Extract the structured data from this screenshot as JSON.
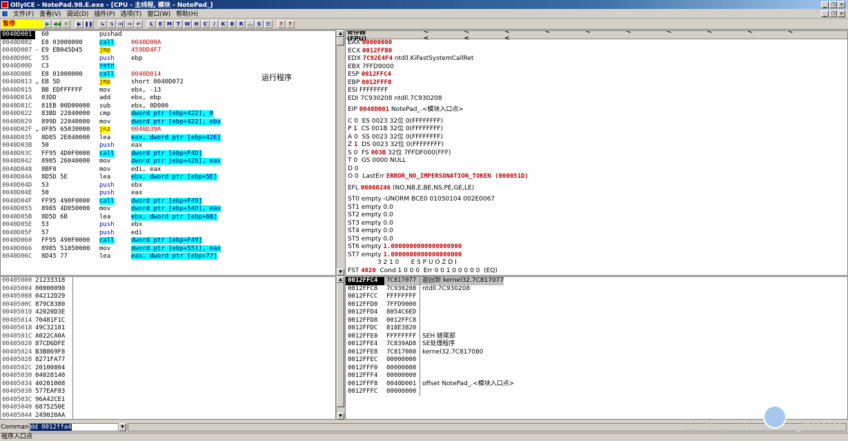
{
  "window": {
    "title": "OllyICE - NotePad.98.E.exe - [CPU - 主线程, 模块 - NotePad_]"
  },
  "menu": [
    "文件(F)",
    "查看(V)",
    "调试(D)",
    "插件(P)",
    "选项(T)",
    "窗口(W)",
    "帮助(H)"
  ],
  "toolbar": {
    "status": "暂停",
    "buttons": [
      "▶",
      "◀◀",
      "✕",
      "▶",
      "❚❚",
      "↳",
      "↴",
      "→|",
      "→",
      "↵",
      "L",
      "E",
      "M",
      "T",
      "W",
      "H",
      "C",
      "/",
      "K",
      "B",
      "R",
      "...",
      "S",
      "☰",
      "?",
      "?"
    ]
  },
  "disasm": {
    "rows": [
      {
        "addr": "0040D001",
        "mk": "",
        "hex": "60",
        "mn": "pushad",
        "op": "",
        "sel": true
      },
      {
        "addr": "0040D002",
        "mk": "",
        "hex": "E8 03000000",
        "mn": "call",
        "op": "0040D00A",
        "mnc": "cyan",
        "opc": "red"
      },
      {
        "addr": "0040D007",
        "mk": "-",
        "hex": "E9 EB045D45",
        "mn": "jmp",
        "op": "459DD4F7",
        "mnc": "yellow",
        "opc": "red"
      },
      {
        "addr": "0040D00C",
        "mk": "",
        "hex": "55",
        "mn": "push",
        "op": "ebp",
        "mnc": "blue"
      },
      {
        "addr": "0040D00D",
        "mk": "",
        "hex": "C3",
        "mn": "retn",
        "op": "",
        "mnc": "cyan"
      },
      {
        "addr": "0040D00E",
        "mk": "",
        "hex": "E8 01000000",
        "mn": "call",
        "op": "0040D014",
        "mnc": "cyan",
        "opc": "red"
      },
      {
        "addr": "0040D013",
        "mk": "⌄",
        "hex": "EB 5D",
        "mn": "jmp",
        "op": "short 0040D072",
        "mnc": "yellow"
      },
      {
        "addr": "0040D015",
        "mk": "",
        "hex": "BB EDFFFFFF",
        "mn": "mov",
        "op": "ebx, -13"
      },
      {
        "addr": "0040D01A",
        "mk": "",
        "hex": "03DD",
        "mn": "add",
        "op": "ebx, ebp"
      },
      {
        "addr": "0040D01C",
        "mk": "",
        "hex": "81EB 00D00000",
        "mn": "sub",
        "op": "ebx, 0D000"
      },
      {
        "addr": "0040D022",
        "mk": "",
        "hex": "83BD 22040000",
        "mn": "cmp",
        "op": "dword ptr [ebp+422], 0",
        "opc": "cyan"
      },
      {
        "addr": "0040D029",
        "mk": "",
        "hex": "899D 22040000",
        "mn": "mov",
        "op": "dword ptr [ebp+422], ebx",
        "opc": "cyan"
      },
      {
        "addr": "0040D02F",
        "mk": "⌄",
        "hex": "0F85 65030000",
        "mn": "jnz",
        "op": "0040D39A",
        "mnc": "yellow",
        "opc": "red"
      },
      {
        "addr": "0040D035",
        "mk": "",
        "hex": "8D85 2E040000",
        "mn": "lea",
        "op": "eax, dword ptr [ebp+42E]",
        "opc": "cyan"
      },
      {
        "addr": "0040D03B",
        "mk": "",
        "hex": "50",
        "mn": "push",
        "op": "eax",
        "mnc": "blue"
      },
      {
        "addr": "0040D03C",
        "mk": "",
        "hex": "FF95 4D0F0000",
        "mn": "call",
        "op": "dword ptr [ebp+F4D]",
        "mnc": "cyan",
        "opc": "cyan"
      },
      {
        "addr": "0040D042",
        "mk": "",
        "hex": "8985 26040000",
        "mn": "mov",
        "op": "dword ptr [ebp+426], eax",
        "opc": "cyan"
      },
      {
        "addr": "0040D048",
        "mk": "",
        "hex": "8BF8",
        "mn": "mov",
        "op": "edi, eax"
      },
      {
        "addr": "0040D04A",
        "mk": "",
        "hex": "8D5D 5E",
        "mn": "lea",
        "op": "ebx, dword ptr [ebp+5E]",
        "opc": "cyan"
      },
      {
        "addr": "0040D04D",
        "mk": "",
        "hex": "53",
        "mn": "push",
        "op": "ebx",
        "mnc": "blue"
      },
      {
        "addr": "0040D04E",
        "mk": "",
        "hex": "50",
        "mn": "push",
        "op": "eax",
        "mnc": "blue"
      },
      {
        "addr": "0040D04F",
        "mk": "",
        "hex": "FF95 490F0000",
        "mn": "call",
        "op": "dword ptr [ebp+F49]",
        "mnc": "cyan",
        "opc": "cyan"
      },
      {
        "addr": "0040D055",
        "mk": "",
        "hex": "8985 4D050000",
        "mn": "mov",
        "op": "dword ptr [ebp+54D], eax",
        "opc": "cyan"
      },
      {
        "addr": "0040D05B",
        "mk": "",
        "hex": "8D5D 6B",
        "mn": "lea",
        "op": "ebx, dword ptr [ebp+6B]",
        "opc": "cyan"
      },
      {
        "addr": "0040D05E",
        "mk": "",
        "hex": "53",
        "mn": "push",
        "op": "ebx",
        "mnc": "blue"
      },
      {
        "addr": "0040D05F",
        "mk": "",
        "hex": "57",
        "mn": "push",
        "op": "edi",
        "mnc": "blue"
      },
      {
        "addr": "0040D060",
        "mk": "",
        "hex": "FF95 490F0000",
        "mn": "call",
        "op": "dword ptr [ebp+F49]",
        "mnc": "cyan",
        "opc": "cyan"
      },
      {
        "addr": "0040D066",
        "mk": "",
        "hex": "8985 51050000",
        "mn": "mov",
        "op": "dword ptr [ebp+551], eax",
        "opc": "cyan"
      },
      {
        "addr": "0040D06C",
        "mk": "",
        "hex": "8D45 77",
        "mn": "lea",
        "op": "eax, dword ptr [ebp+77]",
        "opc": "cyan"
      }
    ],
    "comment": "运行程序"
  },
  "registers": {
    "title": "寄存器 (FPU)",
    "nav": "< < < < < < < < < < < < <",
    "lines": [
      {
        "t": "EAX ",
        "v": "00000000",
        "r": ""
      },
      {
        "t": "ECX ",
        "v": "0012FFB0",
        "r": ""
      },
      {
        "t": "EDX ",
        "v": "7C92E4F4",
        "r": " ntdll.KiFastSystemCallRet"
      },
      {
        "t": "EBX 7FFD9000",
        "v": "",
        "r": ""
      },
      {
        "t": "ESP ",
        "v": "0012FFC4",
        "r": ""
      },
      {
        "t": "EBP ",
        "v": "0012FFF0",
        "r": ""
      },
      {
        "t": "ESI FFFFFFFF",
        "v": "",
        "r": ""
      },
      {
        "t": "EDI 7C930208 ntdll.7C930208",
        "v": "",
        "r": ""
      },
      {
        "gap": true
      },
      {
        "t": "EIP ",
        "v": "0040D001",
        "r": " NotePad_.<模块入口点>"
      },
      {
        "gap": true
      },
      {
        "t": "C 0  ES 0023 32位 0(FFFFFFFF)",
        "v": "",
        "r": ""
      },
      {
        "t": "P ",
        "v": "1",
        "r": "  CS 001B 32位 0(FFFFFFFF)"
      },
      {
        "t": "A 0  SS 0023 32位 0(FFFFFFFF)",
        "v": "",
        "r": ""
      },
      {
        "t": "Z ",
        "v": "1",
        "r": "  DS 0023 32位 0(FFFFFFFF)"
      },
      {
        "t": "S 0  FS ",
        "v": "003B",
        "r": " 32位 7FFDF000(FFF)"
      },
      {
        "t": "T 0  GS 0000 NULL",
        "v": "",
        "r": ""
      },
      {
        "t": "D 0",
        "v": "",
        "r": ""
      },
      {
        "t": "O 0  LastErr ",
        "v": "ERROR_NO_IMPERSONATION_TOKEN (000051D)",
        "r": ""
      },
      {
        "gap": true
      },
      {
        "t": "EFL ",
        "v": "00000246",
        "r": " (NO,NB,E,BE,NS,PE,GE,LE)"
      },
      {
        "gap": true
      },
      {
        "t": "ST0 empty -UNORM BCE0 01050104 002E0067",
        "v": "",
        "r": ""
      },
      {
        "t": "ST1 empty 0.0",
        "v": "",
        "r": ""
      },
      {
        "t": "ST2 empty 0.0",
        "v": "",
        "r": ""
      },
      {
        "t": "ST3 empty 0.0",
        "v": "",
        "r": ""
      },
      {
        "t": "ST4 empty 0.0",
        "v": "",
        "r": ""
      },
      {
        "t": "ST5 empty 0.0",
        "v": "",
        "r": ""
      },
      {
        "t": "ST6 empty ",
        "v": "1.0000000000000000000",
        "r": ""
      },
      {
        "t": "ST7 empty ",
        "v": "1.0000000000000000000",
        "r": ""
      },
      {
        "t": "               3 2 1 0      E S P U O Z D I",
        "v": "",
        "r": ""
      },
      {
        "t": "FST ",
        "v": "4020",
        "r": "  Cond 1 0 0 0  Err 0 0 1 0 0 0 0 0  (EQ)"
      }
    ]
  },
  "dump": {
    "rows": [
      [
        "00405000",
        "21233318"
      ],
      [
        "00405004",
        "00000090"
      ],
      [
        "00405008",
        "04212D29"
      ],
      [
        "0040500C",
        "879C8380"
      ],
      [
        "00405010",
        "42020D3E"
      ],
      [
        "00405014",
        "70481F1C"
      ],
      [
        "00405018",
        "49C32181"
      ],
      [
        "0040501C",
        "A022CA0A"
      ],
      [
        "00405020",
        "87CD6DFE"
      ],
      [
        "00405024",
        "B3B869F8"
      ],
      [
        "00405028",
        "8271FA77"
      ],
      [
        "0040502C",
        "20100804"
      ],
      [
        "00405030",
        "04028140"
      ],
      [
        "00405034",
        "40201008"
      ],
      [
        "00405038",
        "577EAF83"
      ],
      [
        "0040503C",
        "96A42CE1"
      ],
      [
        "00405040",
        "6875250E"
      ],
      [
        "00405044",
        "249020AA"
      ]
    ]
  },
  "stack": {
    "rows": [
      {
        "a": "0012FFC4",
        "v": "7C817077",
        "c": "返回到 kernel32.7C817077",
        "sel": true
      },
      {
        "a": "0012FFC8",
        "v": "7C930208",
        "c": "ntdll.7C930208"
      },
      {
        "a": "0012FFCC",
        "v": "FFFFFFFF",
        "c": ""
      },
      {
        "a": "0012FFD0",
        "v": "7FFD9000",
        "c": ""
      },
      {
        "a": "0012FFD4",
        "v": "8054C6ED",
        "c": ""
      },
      {
        "a": "0012FFD8",
        "v": "0012FFC8",
        "c": ""
      },
      {
        "a": "0012FFDC",
        "v": "818E3820",
        "c": ""
      },
      {
        "a": "0012FFE0",
        "v": "FFFFFFFF",
        "c": "SEH 链尾部"
      },
      {
        "a": "0012FFE4",
        "v": "7C839AD8",
        "c": "SE处理程序"
      },
      {
        "a": "0012FFE8",
        "v": "7C817080",
        "c": "kernel32.7C817080"
      },
      {
        "a": "0012FFEC",
        "v": "00000000",
        "c": ""
      },
      {
        "a": "0012FFF0",
        "v": "00000000",
        "c": ""
      },
      {
        "a": "0012FFF4",
        "v": "00000000",
        "c": ""
      },
      {
        "a": "0012FFF8",
        "v": "0040D001",
        "c": "offset NotePad_.<模块入口点>"
      },
      {
        "a": "0012FFFC",
        "v": "00000000",
        "c": ""
      }
    ]
  },
  "command": {
    "label": "Command",
    "value": "dd 0012ffa4"
  },
  "status": {
    "text": "程序入口点"
  },
  "watermark": "https://blog.csdn.net/weixin_42813492"
}
